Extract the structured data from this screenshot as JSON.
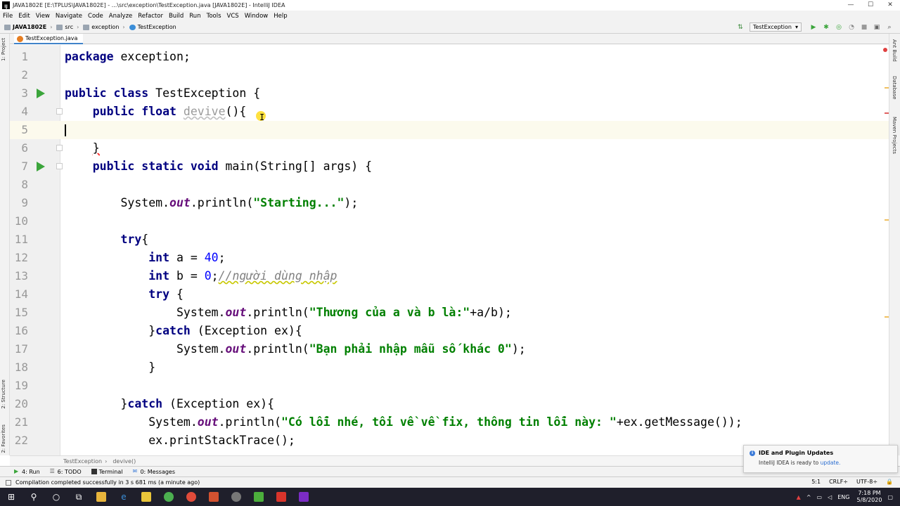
{
  "window": {
    "title": "JAVA1802E [E:\\TPLUS\\JAVA1802E] - ...\\src\\exception\\TestException.java [JAVA1802E] - IntelliJ IDEA",
    "controls": [
      "—",
      "☐",
      "✕"
    ]
  },
  "menu": [
    "File",
    "Edit",
    "View",
    "Navigate",
    "Code",
    "Analyze",
    "Refactor",
    "Build",
    "Run",
    "Tools",
    "VCS",
    "Window",
    "Help"
  ],
  "breadcrumbs": [
    "JAVA1802E",
    "src",
    "exception",
    "TestException"
  ],
  "run_config": "TestException",
  "tab": {
    "label": "TestException.java"
  },
  "left_tools": {
    "project": "1: Project",
    "structure": "2: Structure",
    "favorites": "2: Favorites"
  },
  "right_tools": {
    "ant": "Ant Build",
    "database": "Database",
    "maven": "Maven Projects"
  },
  "editor": {
    "lines": [
      {
        "n": "1"
      },
      {
        "n": "2"
      },
      {
        "n": "3"
      },
      {
        "n": "4"
      },
      {
        "n": "5"
      },
      {
        "n": "6"
      },
      {
        "n": "7"
      },
      {
        "n": "8"
      },
      {
        "n": "9"
      },
      {
        "n": "10"
      },
      {
        "n": "11"
      },
      {
        "n": "12"
      },
      {
        "n": "13"
      },
      {
        "n": "14"
      },
      {
        "n": "15"
      },
      {
        "n": "16"
      },
      {
        "n": "17"
      },
      {
        "n": "18"
      },
      {
        "n": "19"
      },
      {
        "n": "20"
      },
      {
        "n": "21"
      },
      {
        "n": "22"
      }
    ],
    "code": {
      "l1_kw": "package",
      "l1_rest": " exception;",
      "l3_kw": "public class",
      "l3_rest": " TestException {",
      "l4_kw": "public float",
      "l4_name": "devive",
      "l4_rest": "(){",
      "l6": "}",
      "l7_kw": "public static void",
      "l7_rest": " main(String[] args) {",
      "l9_a": "System.",
      "l9_out": "out",
      "l9_b": ".println(",
      "l9_str": "\"Starting...\"",
      "l9_c": ");",
      "l11_kw": "try",
      "l11_rest": "{",
      "l12_kw": "int",
      "l12_a": " a = ",
      "l12_num": "40",
      "l12_b": ";",
      "l13_kw": "int",
      "l13_a": " b = ",
      "l13_num": "0",
      "l13_b": ";",
      "l13_cm": "//người dùng nhập",
      "l14_kw": "try",
      "l14_rest": " {",
      "l15_a": "System.",
      "l15_out": "out",
      "l15_b": ".println(",
      "l15_str": "\"Thương của a và b là:\"",
      "l15_c": "+a/b);",
      "l16_a": "}",
      "l16_kw": "catch",
      "l16_rest": " (Exception ex){",
      "l17_a": "System.",
      "l17_out": "out",
      "l17_b": ".println(",
      "l17_str": "\"Bạn phải nhập mẫu số khác 0\"",
      "l17_c": ");",
      "l18": "}",
      "l20_a": "}",
      "l20_kw": "catch",
      "l20_rest": " (Exception ex){",
      "l21_a": "System.",
      "l21_out": "out",
      "l21_b": ".println(",
      "l21_str": "\"Có lỗi nhé, tối về về fix, thông tin lỗi này: \"",
      "l21_c": "+ex.getMessage());",
      "l22": "ex.printStackTrace();"
    }
  },
  "code_breadcrumb": [
    "TestException",
    "devive()"
  ],
  "tool_windows": [
    "4: Run",
    "6: TODO",
    "Terminal",
    "0: Messages"
  ],
  "status": {
    "message": "Compilation completed successfully in 3 s 681 ms (a minute ago)",
    "position": "5:1",
    "line_sep": "CRLF÷",
    "encoding": "UTF-8÷"
  },
  "notification": {
    "title": "IDE and Plugin Updates",
    "body": "IntelliJ IDEA is ready to",
    "link": "update."
  },
  "taskbar": {
    "lang": "ENG",
    "time": "7:18 PM",
    "date": "5/8/2020"
  },
  "colors": {
    "keyword": "#000080",
    "string": "#008000",
    "number": "#0000ff",
    "comment": "#808080",
    "field": "#660e7a",
    "current_line": "#fcfaed"
  }
}
